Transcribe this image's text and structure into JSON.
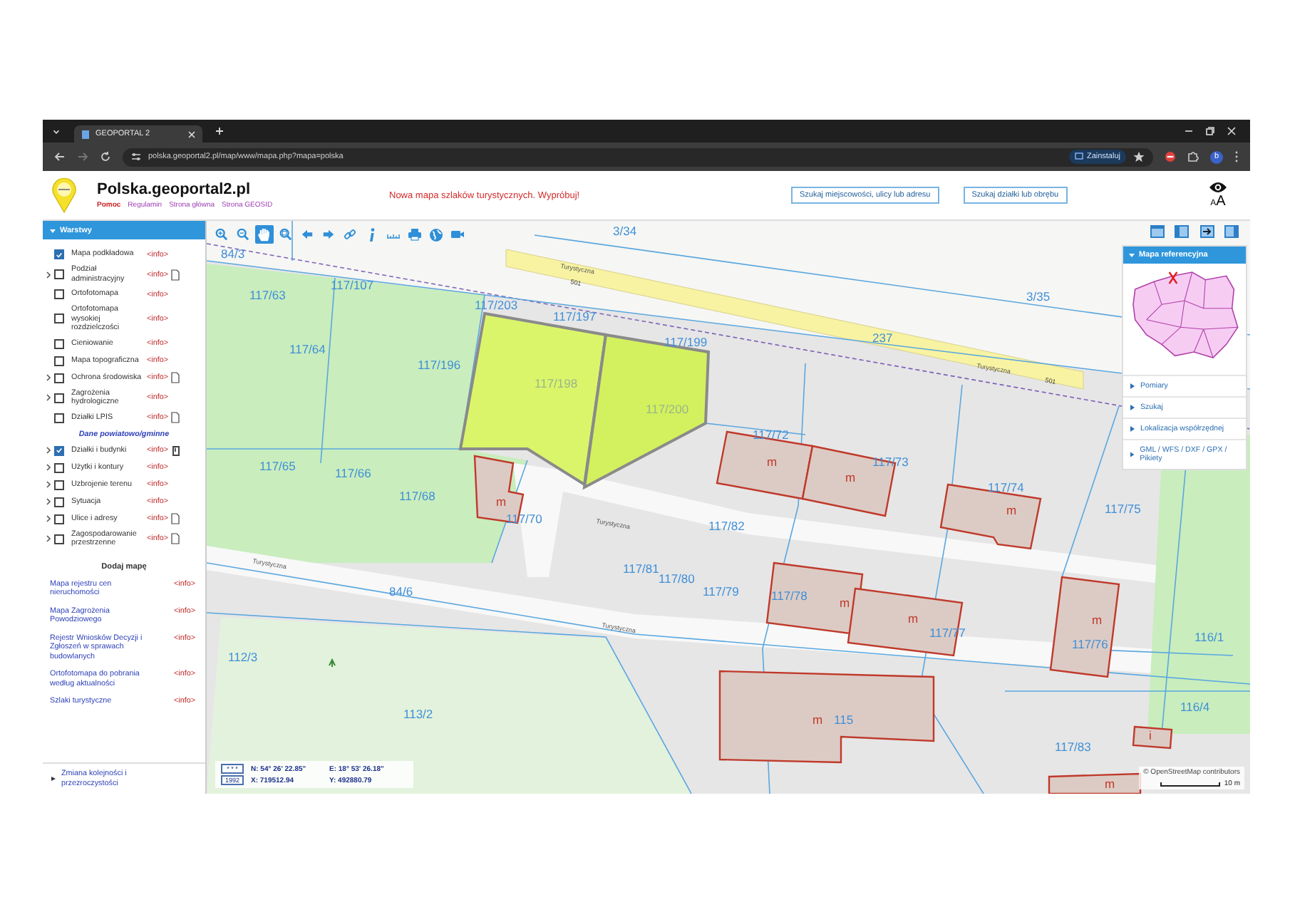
{
  "browser": {
    "tab_title": "GEOPORTAL 2",
    "url": "polska.geoportal2.pl/map/www/mapa.php?mapa=polska",
    "install_button": "Zainstaluj",
    "profile_initial": "b"
  },
  "header": {
    "site_title": "Polska.geoportal2.pl",
    "links": [
      {
        "label": "Pomoc",
        "kind": "help"
      },
      {
        "label": "Regulamin",
        "kind": "page"
      },
      {
        "label": "Strona główna",
        "kind": "page"
      },
      {
        "label": "Strona GEOSID",
        "kind": "page"
      }
    ],
    "announcement": "Nowa mapa szlaków turystycznych. Wypróbuj!",
    "search_buttons": [
      "Szukaj miejscowości, ulicy lub adresu",
      "Szukaj działki lub obrębu"
    ],
    "text_size_letters": [
      "A",
      "A"
    ]
  },
  "layers_panel": {
    "title": "Warstwy",
    "expanded": true,
    "layers": [
      {
        "label": "Mapa podkładowa",
        "checked": true,
        "expandable": false,
        "info": "<info>",
        "document": false
      },
      {
        "label": "Podział administracyjny",
        "checked": false,
        "expandable": true,
        "info": "<info>",
        "document": true
      },
      {
        "label": "Ortofotomapa",
        "checked": false,
        "expandable": false,
        "info": "<info>",
        "document": false
      },
      {
        "label": "Ortofotomapa wysokiej rozdzielczości",
        "checked": false,
        "expandable": false,
        "info": "<info>",
        "document": false
      },
      {
        "label": "Cieniowanie",
        "checked": false,
        "expandable": false,
        "info": "<info>",
        "document": false
      },
      {
        "label": "Mapa topograficzna",
        "checked": false,
        "expandable": false,
        "info": "<info>",
        "document": false
      },
      {
        "label": "Ochrona środowiska",
        "checked": false,
        "expandable": true,
        "info": "<info>",
        "document": true
      },
      {
        "label": "Zagrożenia hydrologiczne",
        "checked": false,
        "expandable": true,
        "info": "<info>",
        "document": false
      },
      {
        "label": "Działki LPIS",
        "checked": false,
        "expandable": false,
        "info": "<info>",
        "document": true
      }
    ],
    "county_section": {
      "title": "Dane powiatowo/gminne",
      "layers": [
        {
          "label": "Działki i budynki",
          "checked": true,
          "expandable": true,
          "info": "<info>",
          "document": true,
          "document_label": "i"
        },
        {
          "label": "Użytki i kontury",
          "checked": false,
          "expandable": true,
          "info": "<info>",
          "document": false
        },
        {
          "label": "Uzbrojenie terenu",
          "checked": false,
          "expandable": true,
          "info": "<info>",
          "document": false
        },
        {
          "label": "Sytuacja",
          "checked": false,
          "expandable": true,
          "info": "<info>",
          "document": false
        },
        {
          "label": "Ulice i adresy",
          "checked": false,
          "expandable": true,
          "info": "<info>",
          "document": true
        },
        {
          "label": "Zagospodarowanie przestrzenne",
          "checked": false,
          "expandable": true,
          "info": "<info>",
          "document": true
        }
      ]
    }
  },
  "add_map": {
    "title": "Dodaj mapę",
    "maps": [
      {
        "label": "Mapa rejestru cen nieruchomości",
        "info": "<info>"
      },
      {
        "label": "Mapa Zagrożenia Powodziowego",
        "info": "<info>"
      },
      {
        "label": "Rejestr Wniosków Decyzji i Zgłoszeń w sprawach budowlanych",
        "info": "<info>"
      },
      {
        "label": "Ortofotomapa do pobrania według aktualności",
        "info": "<info>"
      },
      {
        "label": "Szlaki turystyczne",
        "info": "<info>"
      }
    ]
  },
  "order_link": "Zmiana kolejności i przezroczystości",
  "map": {
    "tools": [
      {
        "kind": "zoom-in",
        "selected": false
      },
      {
        "kind": "zoom-out",
        "selected": false
      },
      {
        "kind": "pan",
        "selected": true
      },
      {
        "kind": "zoom-box",
        "selected": false
      },
      {
        "kind": "back",
        "selected": false
      },
      {
        "kind": "forward",
        "selected": false
      },
      {
        "kind": "link",
        "selected": false
      },
      {
        "kind": "info",
        "selected": false
      },
      {
        "kind": "measure",
        "selected": false
      },
      {
        "kind": "print",
        "selected": false
      },
      {
        "kind": "globe",
        "selected": false
      },
      {
        "kind": "camera",
        "selected": false
      }
    ],
    "labels": [
      {
        "kind": "parcel",
        "text": "3/34"
      },
      {
        "kind": "parcel",
        "text": "84/3"
      },
      {
        "kind": "parcel",
        "text": "117/63"
      },
      {
        "kind": "parcel",
        "text": "117/107"
      },
      {
        "kind": "parcel",
        "text": "117/203"
      },
      {
        "kind": "parcel",
        "text": "117/197"
      },
      {
        "kind": "parcel",
        "text": "117/199"
      },
      {
        "kind": "parcel",
        "text": "3/35"
      },
      {
        "kind": "parcel",
        "text": "237"
      },
      {
        "kind": "road",
        "text": "501"
      },
      {
        "kind": "road",
        "text": "501"
      },
      {
        "kind": "street",
        "text": "Turystyczna"
      },
      {
        "kind": "street",
        "text": "Turystyczna"
      },
      {
        "kind": "street",
        "text": "Turystyczna"
      },
      {
        "kind": "street",
        "text": "Turystyczna"
      },
      {
        "kind": "street",
        "text": "Turystyczna"
      },
      {
        "kind": "parcel",
        "text": "117/64"
      },
      {
        "kind": "parcel",
        "text": "117/196"
      },
      {
        "kind": "parcel-selected",
        "text": "117/198"
      },
      {
        "kind": "parcel-selected",
        "text": "117/200"
      },
      {
        "kind": "parcel",
        "text": "117/72"
      },
      {
        "kind": "parcel",
        "text": "117/73"
      },
      {
        "kind": "parcel",
        "text": "117/65"
      },
      {
        "kind": "parcel",
        "text": "117/66"
      },
      {
        "kind": "parcel",
        "text": "117/68"
      },
      {
        "kind": "parcel",
        "text": "117/70"
      },
      {
        "kind": "building",
        "text": "m"
      },
      {
        "kind": "building",
        "text": "m"
      },
      {
        "kind": "building",
        "text": "m"
      },
      {
        "kind": "parcel",
        "text": "117/74"
      },
      {
        "kind": "building",
        "text": "m"
      },
      {
        "kind": "parcel",
        "text": "117/75"
      },
      {
        "kind": "parcel",
        "text": "117/82"
      },
      {
        "kind": "parcel",
        "text": "117/81"
      },
      {
        "kind": "parcel",
        "text": "117/80"
      },
      {
        "kind": "parcel",
        "text": "117/79"
      },
      {
        "kind": "parcel",
        "text": "117/78"
      },
      {
        "kind": "building",
        "text": "m"
      },
      {
        "kind": "building",
        "text": "m"
      },
      {
        "kind": "parcel",
        "text": "117/77"
      },
      {
        "kind": "parcel",
        "text": "117/76"
      },
      {
        "kind": "building",
        "text": "m"
      },
      {
        "kind": "parcel",
        "text": "116/1"
      },
      {
        "kind": "parcel",
        "text": "84/6"
      },
      {
        "kind": "parcel",
        "text": "112/3"
      },
      {
        "kind": "parcel",
        "text": "113/2"
      },
      {
        "kind": "building",
        "text": "m"
      },
      {
        "kind": "parcel",
        "text": "115"
      },
      {
        "kind": "parcel",
        "text": "116/4"
      },
      {
        "kind": "parcel",
        "text": "117/83"
      },
      {
        "kind": "building",
        "text": "i"
      },
      {
        "kind": "building",
        "text": "m"
      }
    ],
    "coordinates": {
      "projection": "* * *",
      "system": "1992",
      "lat": "N: 54° 26' 22.85\"",
      "lon": "E: 18° 53' 26.18\"",
      "x": "X: 719512.94",
      "y": "Y: 492880.79"
    },
    "attribution": "© OpenStreetMap contributors",
    "scale": "10 m"
  },
  "right_panel": {
    "reference_map": {
      "title": "Mapa referencyjna",
      "expanded": true
    },
    "sections": [
      {
        "label": "Pomiary",
        "expanded": false
      },
      {
        "label": "Szukaj",
        "expanded": false
      },
      {
        "label": "Lokalizacja współrzędnej",
        "expanded": false
      },
      {
        "label": "GML / WFS / DXF / GPX / Pikiety",
        "expanded": false
      }
    ]
  }
}
